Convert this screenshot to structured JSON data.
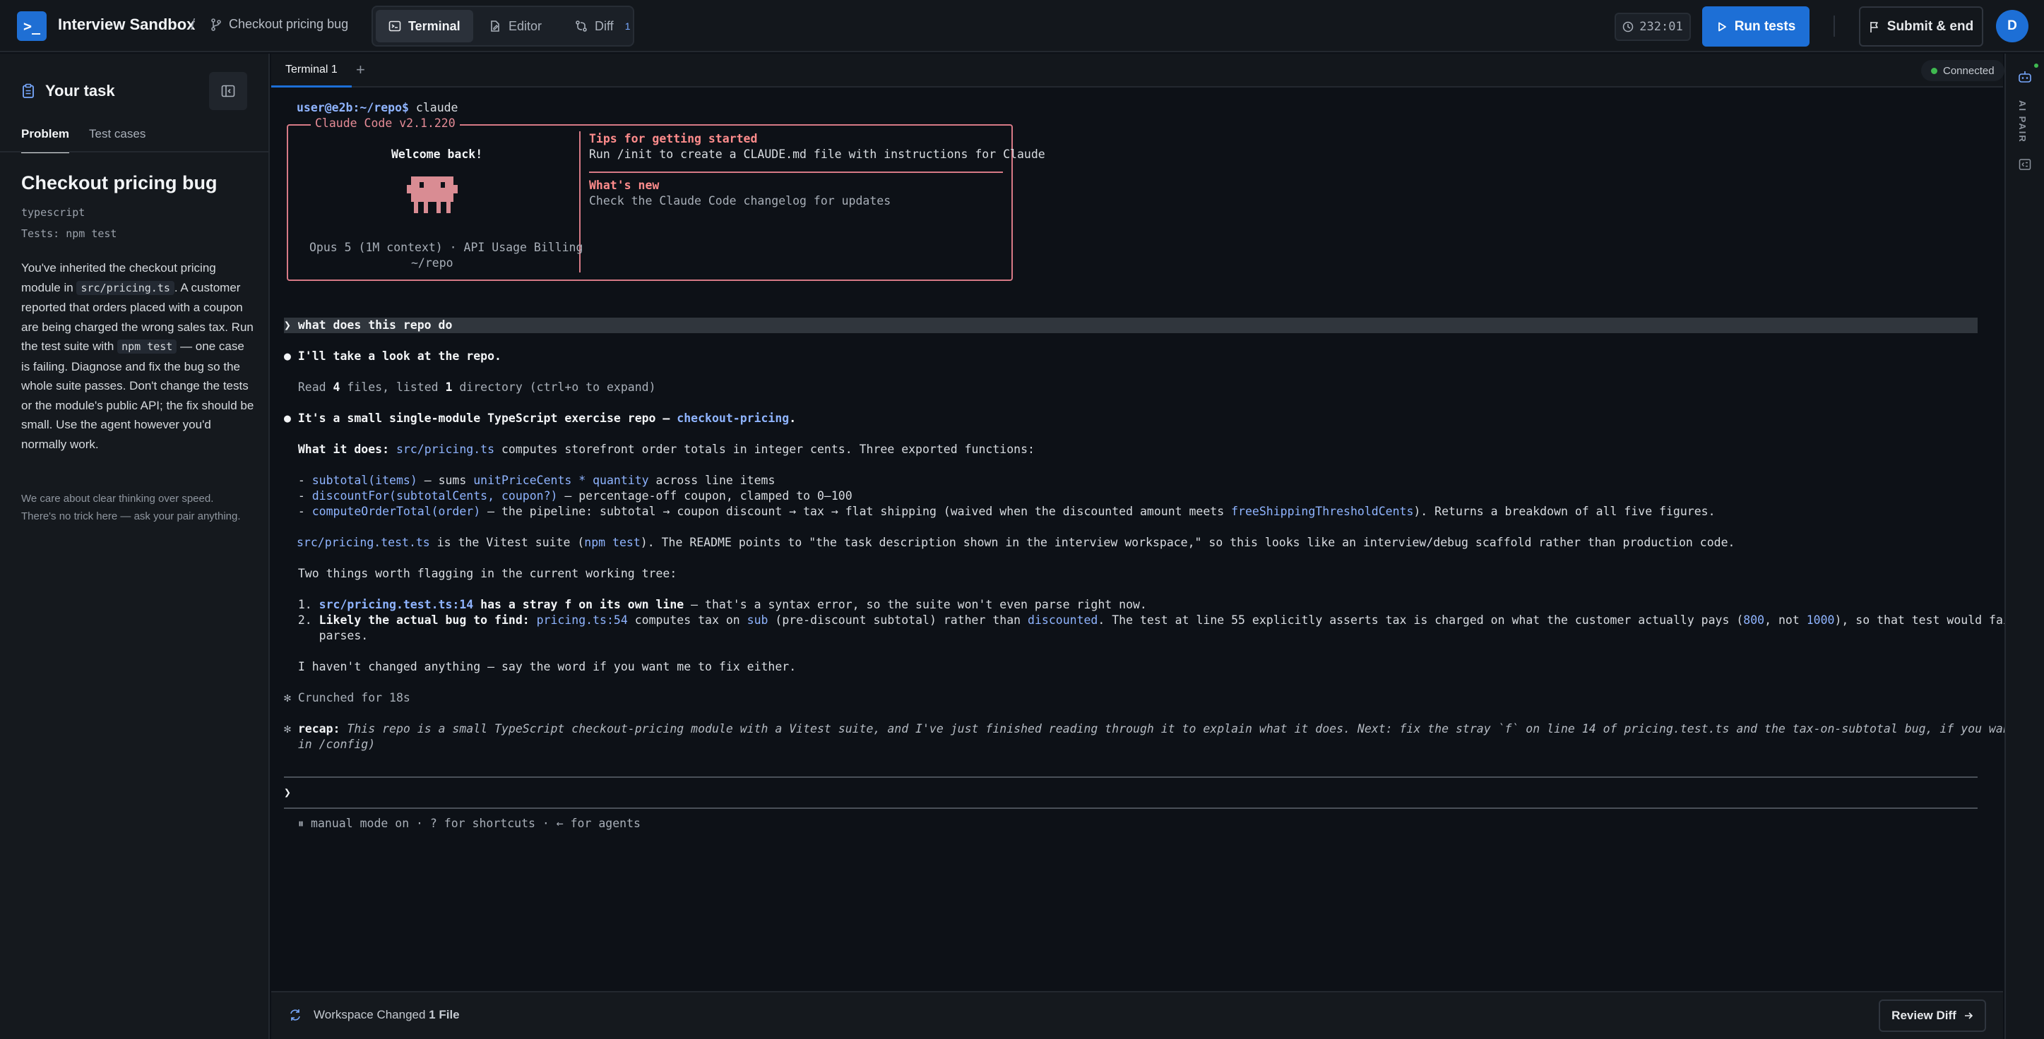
{
  "header": {
    "logo_glyph": ">_",
    "app_title": "Interview Sandbox",
    "separator": "/",
    "breadcrumb": "Checkout pricing bug",
    "tabs": [
      {
        "label": "Terminal",
        "icon": "terminal-icon"
      },
      {
        "label": "Editor",
        "icon": "file-edit-icon"
      },
      {
        "label": "Diff",
        "icon": "git-diff-icon",
        "count": "1"
      }
    ],
    "timer": "232:01",
    "run_tests_label": "Run tests",
    "submit_label": "Submit & end",
    "avatar_initial": "D"
  },
  "sidebar": {
    "heading": "Your task",
    "tabs": [
      "Problem",
      "Test cases"
    ],
    "problem_title": "Checkout pricing bug",
    "language": "typescript",
    "tests_cmd": "Tests: npm test",
    "desc": {
      "p1": "You've inherited the checkout pricing module in",
      "code1": "src/pricing.ts",
      "p2": ". A customer reported that orders placed with a coupon are being charged the wrong sales tax. Run the test suite with",
      "code2": "npm test",
      "p3": "— one case is failing. Diagnose and fix the bug so the whole suite passes. Don't change the tests or the module's public API; the fix should be small. Use the agent however you'd normally work."
    },
    "note": "We care about clear thinking over speed. There's no trick here — ask your pair anything."
  },
  "terminal": {
    "tab_label": "Terminal 1",
    "add_tab": "+",
    "status": "Connected",
    "prompt_user": "user@e2b:~/repo$",
    "command": " claude",
    "box_title": "Claude Code v2.1.220",
    "welcome": "Welcome back!",
    "model_line": "Opus 5 (1M context) · API Usage Billing",
    "cwd": "~/repo",
    "tips_heading": "Tips for getting started",
    "tips_text": "Run /init to create a CLAUDE.md file with instructions for Claude",
    "whats_new_heading": "What's new",
    "whats_new_text": "Check the Claude Code changelog for updates",
    "user_message": "❯ what does this repo do",
    "reply1": "● I'll take a look at the repo.",
    "read_a": "  Read ",
    "read_n1": "4",
    "read_b": " files, listed ",
    "read_n2": "1",
    "read_c": " directory (ctrl+o to expand)",
    "summary_a": "● It's a small single-module TypeScript exercise repo — ",
    "summary_name": "checkout-pricing",
    "summary_b": ".",
    "what_label": "  What it does: ",
    "what_file": "src/pricing.ts",
    "what_rest": " computes storefront order totals in integer cents. Three exported functions:",
    "f1_a": "  - ",
    "f1_fn": "subtotal(items)",
    "f1_b": " — sums ",
    "f1_expr": "unitPriceCents * quantity",
    "f1_c": " across line items",
    "f2_a": "  - ",
    "f2_fn": "discountFor(subtotalCents, coupon?)",
    "f2_b": " — percentage-off coupon, clamped to 0–100",
    "f3_a": "  - ",
    "f3_fn": "computeOrderTotal(order)",
    "f3_b": " — the pipeline: subtotal → coupon discount → tax → flat shipping (waived when the discounted amount meets ",
    "f3_var": "freeShippingThresholdCents",
    "f3_c": "). Returns a breakdown of all five figures.",
    "suite_file": "src/pricing.test.ts",
    "suite_a": " is the Vitest suite (",
    "suite_cmd": "npm test",
    "suite_b": "). The README points to \"the task description shown in the interview workspace,\" so this looks like an interview/debug scaffold rather than production code.",
    "flag_intro": "  Two things worth flagging in the current working tree:",
    "i1_num": "  1. ",
    "i1_file": "src/pricing.test.ts:14",
    "i1_bold": " has a stray f on its own line",
    "i1_rest": " — that's a syntax error, so the suite won't even parse right now.",
    "i2_num": "  2. ",
    "i2_bold": "Likely the actual bug to find: ",
    "i2_loc": "pricing.ts:54",
    "i2_a": " computes tax on ",
    "i2_sub": "sub",
    "i2_b": " (pre-discount subtotal) rather than ",
    "i2_disc": "discounted",
    "i2_c": ". The test at line 55 explicitly asserts tax is charged on what the customer actually pays (",
    "i2_n1": "800",
    "i2_d": ", not ",
    "i2_n2": "1000",
    "i2_e": "), so that test would fail once the file",
    "i2_wrap": "     parses.",
    "closing": "  I haven't changed anything — say the word if you want me to fix either.",
    "crunched": "✻ Crunched for 18s",
    "recap_label": "recap:",
    "recap_text1": " This repo is a small TypeScript checkout-pricing module with a Vitest suite, and I've just finished reading through it to explain what it does. Next: fix the stray `f` on line 14 of pricing.test.ts and the tax-on-subtotal bug, if you want. (disable recaps",
    "recap_text2": "  in /config)",
    "input_prompt": "❯",
    "mode_line": "  ⏸ manual mode on · ? for shortcuts · ← for agents"
  },
  "bottom": {
    "ws_prefix": "Workspace Changed ",
    "ws_count": "1 File",
    "review_label": "Review Diff"
  },
  "rail": {
    "label": "AI PAIR"
  },
  "colors": {
    "accent": "#1d6fd6",
    "claude_border": "#d77a86",
    "link": "#8fb4ff",
    "connected": "#3fb950"
  }
}
